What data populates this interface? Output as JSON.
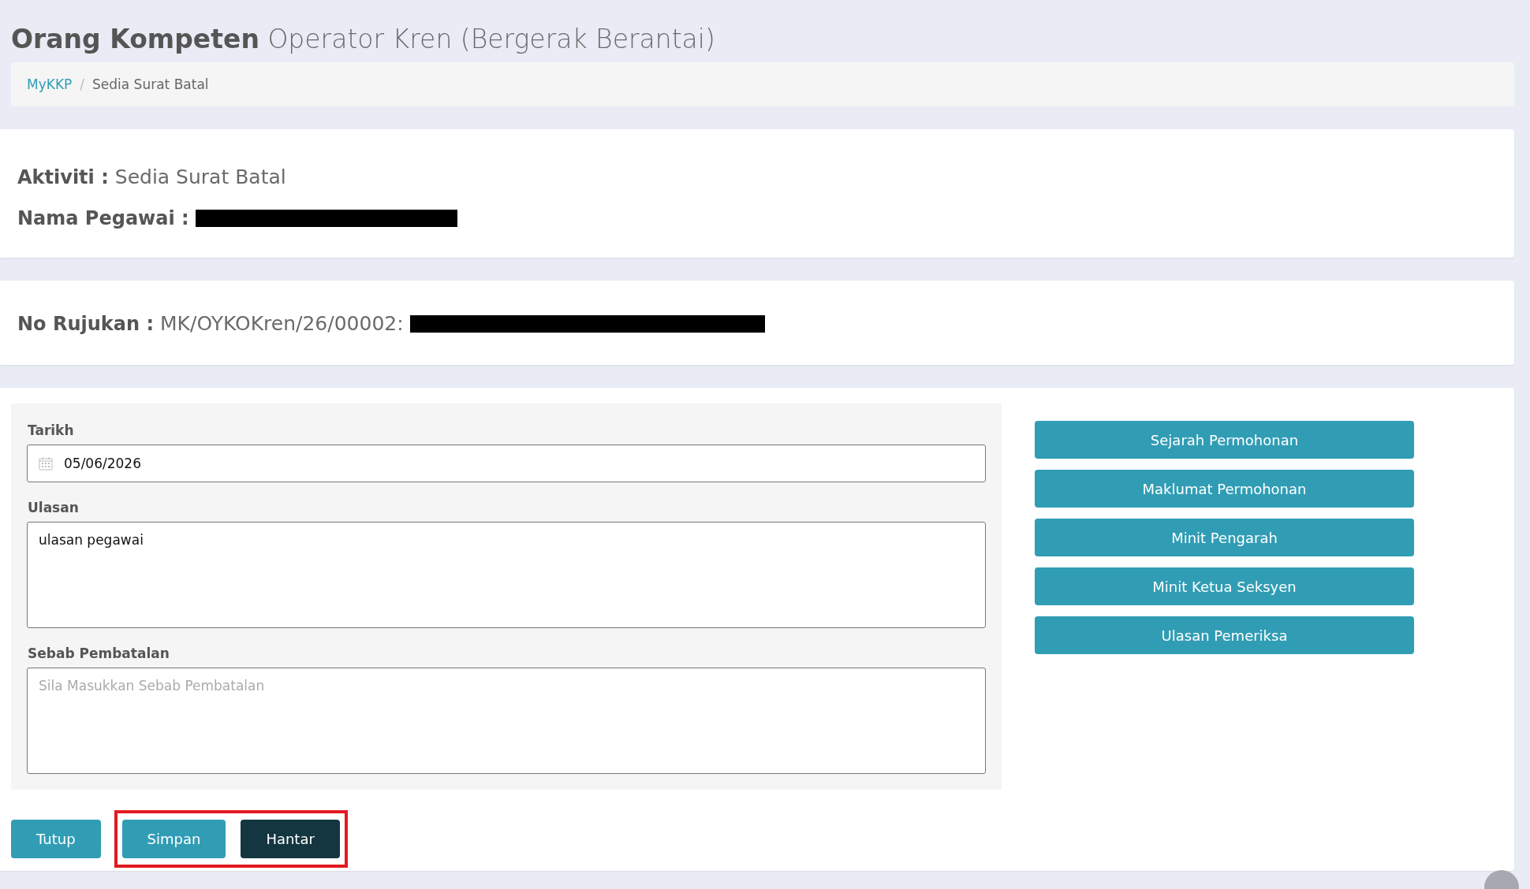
{
  "page_title": {
    "bold": "Orang Kompeten",
    "rest": "Operator Kren (Bergerak Berantai)"
  },
  "breadcrumb_separator": "/",
  "breadcrumb": [
    {
      "label": "MyKKP",
      "kind": "link"
    },
    {
      "label": "Sedia Surat Batal",
      "kind": "current"
    }
  ],
  "info_card": [
    {
      "label": "Aktiviti :",
      "value": "Sedia Surat Batal"
    },
    {
      "label": "Nama Pegawai :",
      "redacted": true
    }
  ],
  "reference_card": [
    {
      "label": "No Rujukan :",
      "value": "MK/OYKOKren/26/00002:",
      "redacted": true
    }
  ],
  "form": {
    "fields": [
      {
        "kind": "date",
        "label": "Tarikh",
        "value": "05/06/2026"
      },
      {
        "kind": "textarea",
        "label": "Ulasan",
        "value": "ulasan pegawai"
      },
      {
        "kind": "textarea",
        "label": "Sebab Pembatalan",
        "placeholder": "Sila Masukkan Sebab Pembatalan"
      }
    ]
  },
  "side_buttons": [
    "Sejarah Permohonan",
    "Maklumat Permohonan",
    "Minit Pengarah",
    "Minit Ketua Seksyen",
    "Ulasan Pemeriksa"
  ],
  "action_buttons": [
    {
      "label": "Tutup",
      "kind": "info",
      "highlighted": false
    },
    {
      "label": "Simpan",
      "kind": "info",
      "highlighted": true
    },
    {
      "label": "Hantar",
      "kind": "dark",
      "highlighted": true
    }
  ]
}
